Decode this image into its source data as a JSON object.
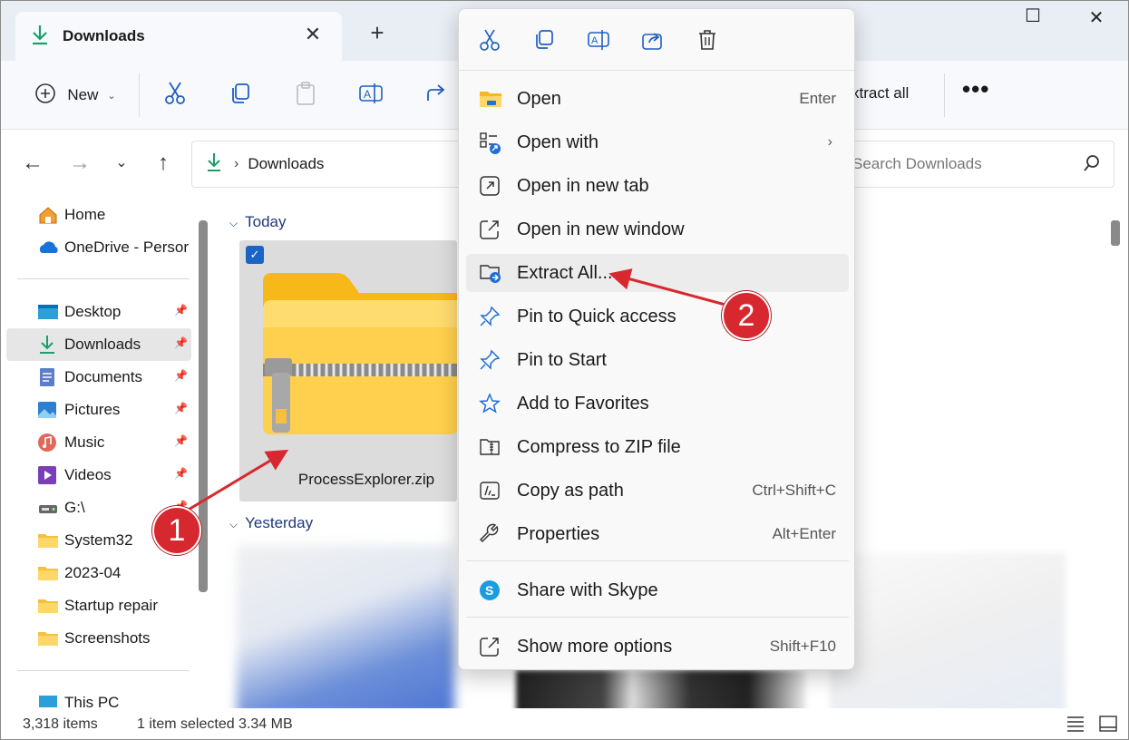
{
  "window": {
    "tab_title": "Downloads",
    "close_tab": "✕",
    "new_tab": "+",
    "minimize": "—",
    "maximize": "☐",
    "close_window": "✕"
  },
  "commandbar": {
    "new_label": "New",
    "extract_all_label": "xtract all",
    "more_label": "•••"
  },
  "address": {
    "crumb": "Downloads",
    "search_placeholder": "Search Downloads"
  },
  "sidebar": {
    "items": [
      {
        "label": "Home",
        "icon": "home-icon"
      },
      {
        "label": "OneDrive - Persor",
        "icon": "onedrive-icon"
      },
      {
        "label": "Desktop",
        "icon": "desktop-icon",
        "pinned": true
      },
      {
        "label": "Downloads",
        "icon": "downloads-icon",
        "pinned": true,
        "selected": true
      },
      {
        "label": "Documents",
        "icon": "documents-icon",
        "pinned": true
      },
      {
        "label": "Pictures",
        "icon": "pictures-icon",
        "pinned": true
      },
      {
        "label": "Music",
        "icon": "music-icon",
        "pinned": true
      },
      {
        "label": "Videos",
        "icon": "videos-icon",
        "pinned": true
      },
      {
        "label": "G:\\",
        "icon": "drive-icon",
        "pinned": true
      },
      {
        "label": "System32",
        "icon": "folder-icon"
      },
      {
        "label": "2023-04",
        "icon": "folder-icon"
      },
      {
        "label": "Startup repair",
        "icon": "folder-icon"
      },
      {
        "label": "Screenshots",
        "icon": "folder-icon"
      },
      {
        "label": "This PC",
        "icon": "pc-icon"
      }
    ]
  },
  "content": {
    "group_today": "Today",
    "group_yesterday": "Yesterday",
    "selected_file": "ProcessExplorer.zip"
  },
  "context_menu": {
    "items": [
      {
        "label": "Open",
        "shortcut": "Enter",
        "icon": "folder-open-icon"
      },
      {
        "label": "Open with",
        "shortcut": "",
        "icon": "open-with-icon",
        "submenu": true
      },
      {
        "label": "Open in new tab",
        "shortcut": "",
        "icon": "new-tab-icon"
      },
      {
        "label": "Open in new window",
        "shortcut": "",
        "icon": "new-window-icon"
      },
      {
        "label": "Extract All...",
        "shortcut": "",
        "icon": "extract-icon",
        "hover": true
      },
      {
        "label": "Pin to Quick access",
        "shortcut": "",
        "icon": "pin-icon"
      },
      {
        "label": "Pin to Start",
        "shortcut": "",
        "icon": "pin-icon"
      },
      {
        "label": "Add to Favorites",
        "shortcut": "",
        "icon": "star-icon"
      },
      {
        "label": "Compress to ZIP file",
        "shortcut": "",
        "icon": "zip-icon"
      },
      {
        "label": "Copy as path",
        "shortcut": "Ctrl+Shift+C",
        "icon": "copy-path-icon"
      },
      {
        "label": "Properties",
        "shortcut": "Alt+Enter",
        "icon": "wrench-icon"
      },
      {
        "label": "Share with Skype",
        "shortcut": "",
        "icon": "skype-icon"
      },
      {
        "label": "Show more options",
        "shortcut": "Shift+F10",
        "icon": "more-options-icon"
      }
    ]
  },
  "status": {
    "items_count": "3,318 items",
    "selection": "1 item selected  3.34 MB"
  },
  "annotations": {
    "badge_1": "1",
    "badge_2": "2",
    "color": "#d8282f"
  },
  "colors": {
    "accent": "#1a63c7",
    "selected_bg": "#e6e6e6",
    "menu_bg": "#f9f9f9"
  }
}
